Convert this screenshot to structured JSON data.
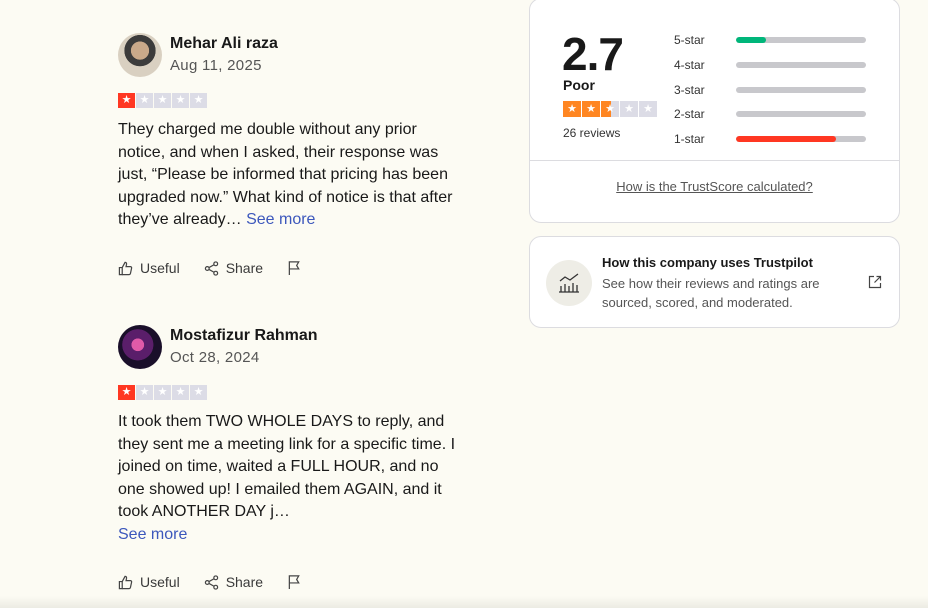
{
  "reviews": [
    {
      "name": "Mehar Ali raza",
      "date": "Aug 11, 2025",
      "rating": 1,
      "text": "They charged me double without any prior notice, and when I asked, their response was just, “Please be informed that pricing has been upgraded now.” What kind of notice is that after they’ve already…",
      "see_more": "See more"
    },
    {
      "name": "Mostafizur Rahman",
      "date": "Oct 28, 2024",
      "rating": 1,
      "text": "It took them TWO WHOLE DAYS to reply, and they sent me a meeting link for a specific time. I joined on time, waited a FULL HOUR, and no one showed up! I emailed them AGAIN, and it took ANOTHER DAY j…",
      "see_more": "See more"
    }
  ],
  "actions": {
    "useful": "Useful",
    "share": "Share"
  },
  "trustscore": {
    "score": "2.7",
    "label": "Poor",
    "stars_filled": 2.5,
    "review_count": "26 reviews",
    "distribution": [
      {
        "label": "5-star",
        "fraction": 0.23,
        "color": "#00b67a"
      },
      {
        "label": "4-star",
        "fraction": 0.0,
        "color": "#00b67a"
      },
      {
        "label": "3-star",
        "fraction": 0.0,
        "color": "#ffce00"
      },
      {
        "label": "2-star",
        "fraction": 0.0,
        "color": "#ff8622"
      },
      {
        "label": "1-star",
        "fraction": 0.77,
        "color": "#ff3722"
      }
    ],
    "calc_link": "How is the TrustScore calculated?"
  },
  "info_card": {
    "title": "How this company uses Trustpilot",
    "description": "See how their reviews and ratings are sourced, scored, and moderated.",
    "icon": "chart-icon",
    "link_icon": "external-link-icon"
  }
}
